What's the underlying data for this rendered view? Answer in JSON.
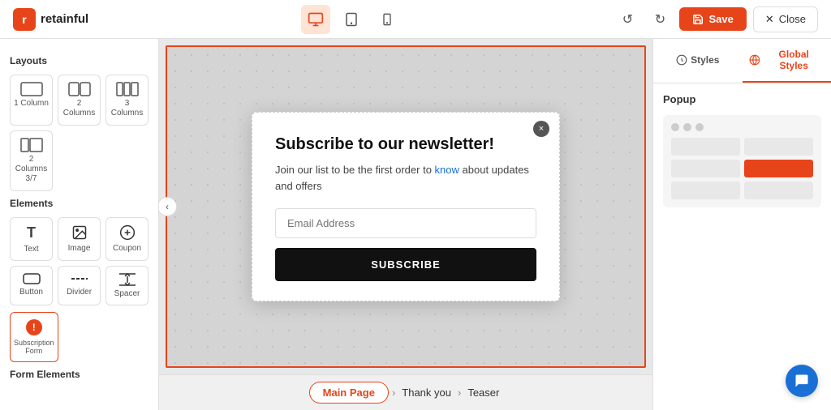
{
  "app": {
    "logo_letter": "r",
    "logo_name": "retainful"
  },
  "topbar": {
    "view_desktop_label": "desktop",
    "view_tablet_label": "tablet",
    "view_mobile_label": "mobile",
    "undo_label": "undo",
    "redo_label": "redo",
    "save_label": "Save",
    "close_label": "Close"
  },
  "sidebar": {
    "layouts_title": "Layouts",
    "elements_title": "Elements",
    "form_elements_title": "Form Elements",
    "layouts": [
      {
        "label": "1 Column",
        "icon": "▭"
      },
      {
        "label": "2 Columns",
        "icon": "▭▭"
      },
      {
        "label": "3 Columns",
        "icon": "▭▭▭"
      },
      {
        "label": "2 Columns 3/7",
        "icon": "▭▭"
      }
    ],
    "elements": [
      {
        "label": "Text",
        "icon": "T"
      },
      {
        "label": "Image",
        "icon": "🖼"
      },
      {
        "label": "Coupon",
        "icon": "✱"
      },
      {
        "label": "Button",
        "icon": "▬"
      },
      {
        "label": "Divider",
        "icon": "—"
      },
      {
        "label": "Spacer",
        "icon": "↕"
      },
      {
        "label": "Subscription Form",
        "icon": "!"
      }
    ]
  },
  "popup": {
    "title": "Subscribe to our newsletter!",
    "description": "Join our list to be the first order to know about updates and offers",
    "description_link_word": "know",
    "email_placeholder": "Email Address",
    "subscribe_btn": "SUBSCRIBE",
    "close_btn": "×"
  },
  "pages": [
    {
      "label": "Main Page",
      "active": true
    },
    {
      "label": "Thank you"
    },
    {
      "label": "Teaser"
    }
  ],
  "right_panel": {
    "styles_tab": "Styles",
    "global_styles_tab": "Global Styles",
    "popup_section_title": "Popup"
  }
}
